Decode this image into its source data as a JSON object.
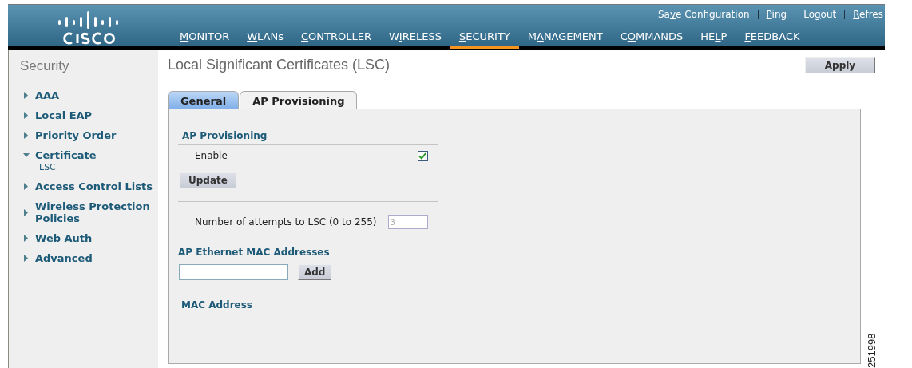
{
  "header": {
    "links": [
      {
        "pre": "Sa",
        "key": "v",
        "post": "e Configuration"
      },
      {
        "key": "P",
        "post": "ing"
      },
      {
        "pre": "Lo",
        "key": "g",
        "post": "out"
      },
      {
        "key": "R",
        "post": "efres"
      }
    ],
    "nav": [
      {
        "key": "M",
        "post": "ONITOR",
        "selected": false
      },
      {
        "key": "W",
        "post": "LANs",
        "selected": false
      },
      {
        "key": "C",
        "post": "ONTROLLER",
        "selected": false
      },
      {
        "pre": "W",
        "key": "I",
        "post": "RELESS",
        "selected": false
      },
      {
        "key": "S",
        "post": "ECURITY",
        "selected": true
      },
      {
        "pre": "M",
        "key": "A",
        "post": "NAGEMENT",
        "selected": false
      },
      {
        "pre": "C",
        "key": "O",
        "post": "MMANDS",
        "selected": false
      },
      {
        "pre": "HE",
        "key": "L",
        "post": "P",
        "selected": false
      },
      {
        "key": "F",
        "post": "EEDBACK",
        "selected": false
      }
    ]
  },
  "sidebar": {
    "title": "Security",
    "items": [
      {
        "label": "AAA",
        "expanded": false
      },
      {
        "label": "Local EAP",
        "expanded": false
      },
      {
        "label": "Priority Order",
        "expanded": false
      },
      {
        "label": "Certificate",
        "expanded": true,
        "children": [
          {
            "label": "LSC"
          }
        ]
      },
      {
        "label": "Access Control Lists",
        "expanded": false
      },
      {
        "label": "Wireless Protection Policies",
        "expanded": false
      },
      {
        "label": "Web Auth",
        "expanded": false
      },
      {
        "label": "Advanced",
        "expanded": false
      }
    ]
  },
  "page": {
    "title": "Local Significant Certificates (LSC)",
    "apply_button": "Apply",
    "tabs": [
      {
        "label": "General",
        "selected": false
      },
      {
        "label": "AP Provisioning",
        "selected": true
      }
    ],
    "section_title": "AP Provisioning",
    "enable": {
      "label": "Enable",
      "checked": true
    },
    "update_button": "Update",
    "attempts": {
      "label": "Number of attempts to LSC (0 to 255)",
      "value": "3",
      "disabled": true
    },
    "mac_title": "AP Ethernet MAC Addresses",
    "add_button": "Add",
    "mac_column": "MAC Address"
  },
  "figure_number": "251998"
}
